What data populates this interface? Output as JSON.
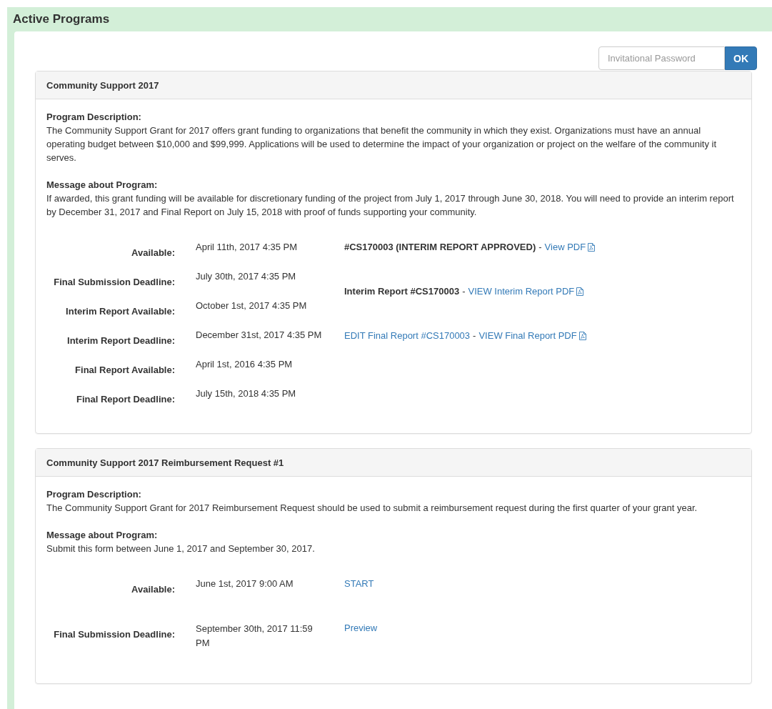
{
  "panel_title": "Active Programs",
  "password": {
    "placeholder": "Invitational Password",
    "button": "OK"
  },
  "programs": [
    {
      "title": "Community Support 2017",
      "description_label": "Program Description:",
      "description": "The Community Support Grant for 2017 offers grant funding to organizations that benefit the community in which they exist. Organizations must have an annual operating budget between $10,000 and $99,999. Applications will be used to determine the impact of your organization or project on the welfare of the community it serves.",
      "message_label": "Message about Program:",
      "message": "If awarded, this grant funding will be available for discretionary funding of the project from July 1, 2017 through June 30, 2018. You will need to provide an interim report by December 31, 2017 and Final Report on July 15, 2018 with proof of funds supporting your community.",
      "dates": [
        {
          "label": "Available:",
          "value": "April 11th, 2017 4:35 PM"
        },
        {
          "label": "Final Submission Deadline:",
          "value": "July 30th, 2017 4:35 PM"
        },
        {
          "label": "Interim Report Available:",
          "value": "October 1st, 2017 4:35 PM"
        },
        {
          "label": "Interim Report Deadline:",
          "value": "December 31st, 2017 4:35 PM"
        },
        {
          "label": "Final Report Available:",
          "value": "April 1st, 2016 4:35 PM"
        },
        {
          "label": "Final Report Deadline:",
          "value": "July 15th, 2018 4:35 PM"
        }
      ],
      "actions": [
        [
          {
            "kind": "label",
            "text": "#CS170003 (INTERIM REPORT APPROVED)"
          },
          {
            "kind": "sep",
            "text": "-"
          },
          {
            "kind": "pdf-link",
            "text": "View PDF"
          }
        ],
        [
          {
            "kind": "label",
            "text": "Interim Report #CS170003"
          },
          {
            "kind": "sep",
            "text": "-"
          },
          {
            "kind": "pdf-link",
            "text": "VIEW Interim Report PDF"
          }
        ],
        [
          {
            "kind": "link",
            "text": "EDIT Final Report #CS170003"
          },
          {
            "kind": "sep",
            "text": "-"
          },
          {
            "kind": "pdf-link",
            "text": "VIEW Final Report PDF"
          }
        ]
      ]
    },
    {
      "title": "Community Support 2017 Reimbursement Request #1",
      "description_label": "Program Description:",
      "description": "The Community Support Grant for 2017 Reimbursement Request should be used to submit a reimbursement request during the first quarter of your grant year.",
      "message_label": "Message about Program:",
      "message": "Submit this form between June 1, 2017 and September 30, 2017.",
      "dates": [
        {
          "label": "Available:",
          "value": "June 1st, 2017 9:00 AM"
        },
        {
          "label": "Final Submission Deadline:",
          "value": "September 30th, 2017 11:59 PM"
        }
      ],
      "actions": [
        [
          {
            "kind": "link",
            "text": "START"
          }
        ],
        [
          {
            "kind": "link",
            "text": "Preview"
          }
        ]
      ]
    }
  ]
}
